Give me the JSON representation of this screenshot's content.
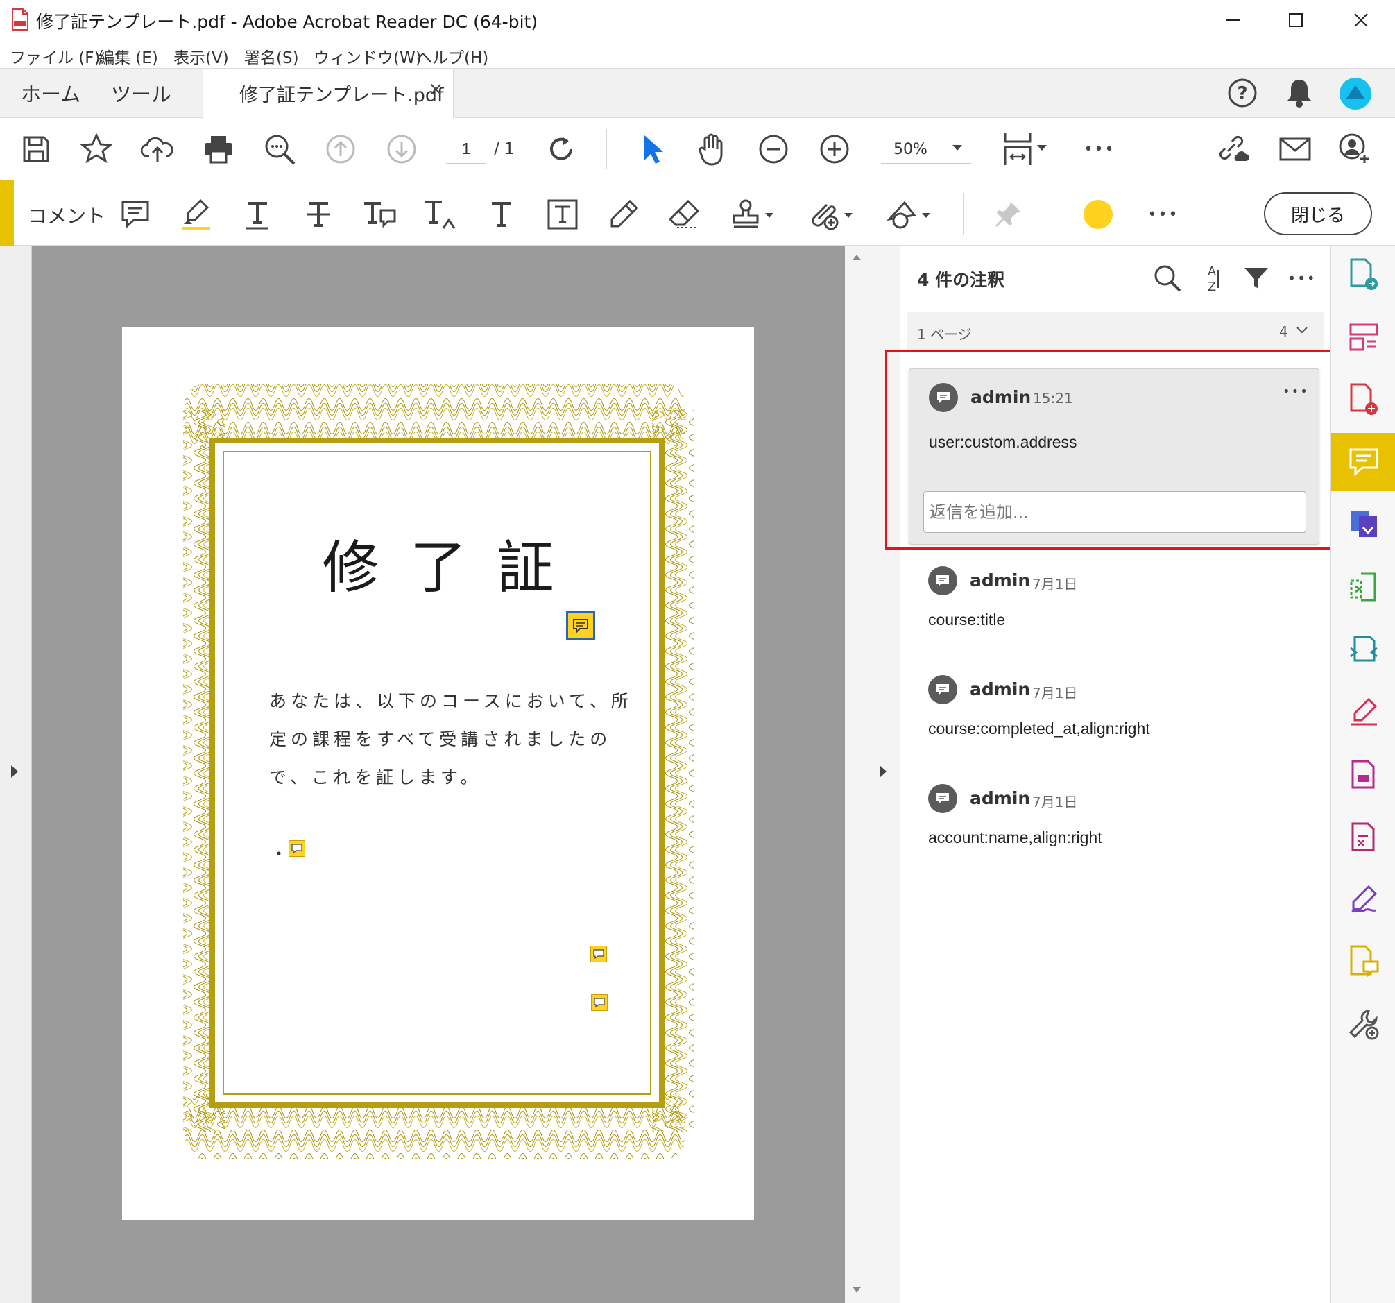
{
  "window": {
    "title": "修了証テンプレート.pdf - Adobe Acrobat Reader DC (64-bit)"
  },
  "menu": {
    "items": [
      "ファイル (F)",
      "編集 (E)",
      "表示(V)",
      "署名(S)",
      "ウィンドウ(W)",
      "ヘルプ(H)"
    ]
  },
  "tabs": {
    "home": "ホーム",
    "tools": "ツール",
    "document": "修了証テンプレート.pdf",
    "close_glyph": "×"
  },
  "toolbar": {
    "page_current": "1",
    "page_total": "/ 1",
    "zoom": "50%",
    "more_glyph": "•••"
  },
  "comment_toolbar": {
    "label": "コメント",
    "close_label": "閉じる",
    "color": "#ffd21f"
  },
  "document": {
    "title": "修了証",
    "body_lines": [
      "あなたは、以下のコースにおいて、所",
      "定の課程をすべて受講されましたの",
      "で、これを証します。"
    ],
    "bullet": "・",
    "border_color": "#b59e10"
  },
  "comments_panel": {
    "title": "4 件の注釈",
    "page_group_label": "1 ページ",
    "page_group_count": "4",
    "reply_placeholder": "返信を追加...",
    "comments": [
      {
        "author": "admin",
        "time": "15:21",
        "text": "user:custom.address"
      },
      {
        "author": "admin",
        "time": "7月1日",
        "text": "course:title"
      },
      {
        "author": "admin",
        "time": "7月1日",
        "text": "course:completed_at,align:right"
      },
      {
        "author": "admin",
        "time": "7月1日",
        "text": "account:name,align:right"
      }
    ]
  },
  "colors": {
    "accent": "#e8c200",
    "highlight_box": "#e3131b",
    "select_tool": "#1473e6"
  }
}
